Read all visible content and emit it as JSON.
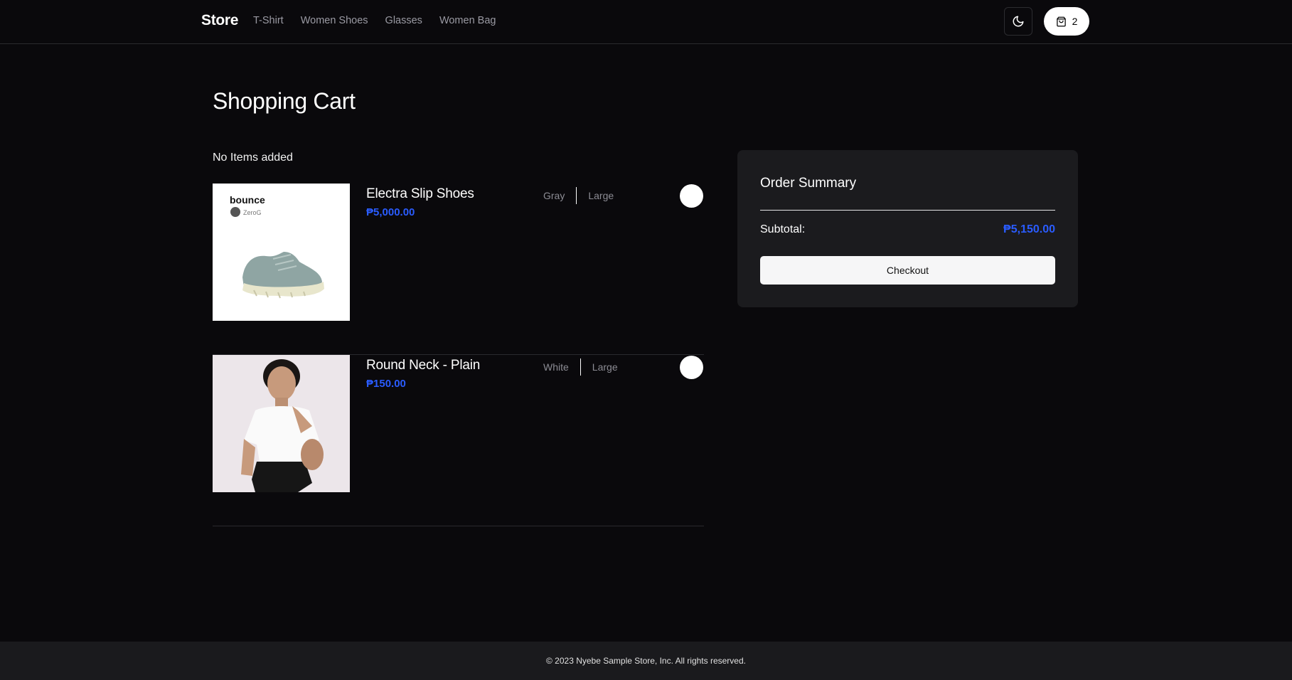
{
  "header": {
    "logo": "Store",
    "nav": [
      "T-Shirt",
      "Women Shoes",
      "Glasses",
      "Women Bag"
    ],
    "theme_icon": "moon-icon",
    "cart_icon": "shopping-bag-icon",
    "cart_count": "2"
  },
  "main": {
    "title": "Shopping Cart",
    "empty_message": "No Items added",
    "items": [
      {
        "name": "Electra Slip Shoes",
        "price": "₱5,000.00",
        "color": "Gray",
        "size": "Large",
        "image_brand": "bounce",
        "image_sub": "ZeroG"
      },
      {
        "name": "Round Neck - Plain",
        "price": "₱150.00",
        "color": "White",
        "size": "Large"
      }
    ]
  },
  "summary": {
    "title": "Order Summary",
    "subtotal_label": "Subtotal:",
    "subtotal_value": "₱5,150.00",
    "checkout_label": "Checkout"
  },
  "footer": {
    "copyright": "© 2023 Nyebe Sample Store, Inc. All rights reserved."
  },
  "colors": {
    "background": "#0a090c",
    "accent_price": "#2a5cff",
    "panel": "#1b1b1e"
  }
}
